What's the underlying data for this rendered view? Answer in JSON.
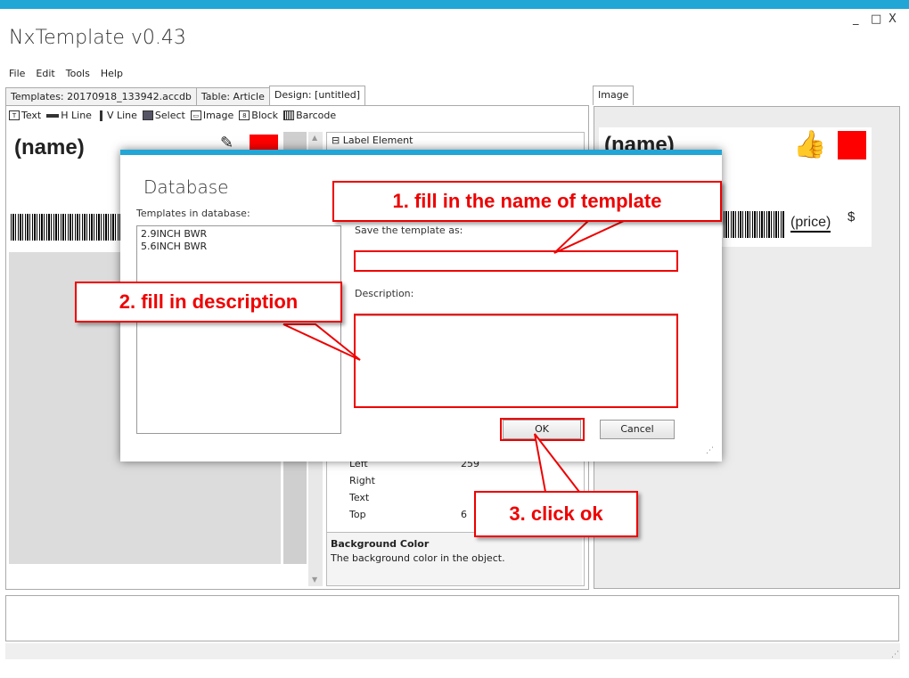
{
  "window": {
    "title": "NxTemplate v0.43",
    "controls": [
      "_",
      "□",
      "X"
    ]
  },
  "menu": [
    "File",
    "Edit",
    "Tools",
    "Help"
  ],
  "tabs": [
    {
      "label": "Templates: 20170918_133942.accdb",
      "active": false
    },
    {
      "label": "Table: Article",
      "active": false
    },
    {
      "label": "Design: [untitled]",
      "active": true
    }
  ],
  "image_tab": "Image",
  "toolbar": [
    {
      "label": "Text",
      "icon": "text-icon"
    },
    {
      "label": "H Line",
      "icon": "hline-icon"
    },
    {
      "label": "V Line",
      "icon": "vline-icon"
    },
    {
      "label": "Select",
      "icon": "select-icon"
    },
    {
      "label": "Image",
      "icon": "image-icon"
    },
    {
      "label": "Block",
      "icon": "block-icon"
    },
    {
      "label": "Barcode",
      "icon": "barcode-icon"
    }
  ],
  "design": {
    "name_field": "(name)"
  },
  "preview": {
    "name_field": "(name)",
    "price_field": "(price)",
    "currency": "$"
  },
  "properties": {
    "category": "Label Element",
    "rows": [
      {
        "name": "Left",
        "value": "259"
      },
      {
        "name": "Right",
        "value": ""
      },
      {
        "name": "Text",
        "value": ""
      },
      {
        "name": "Top",
        "value": "6"
      }
    ],
    "help_title": "Background Color",
    "help_text": "The background color in the object."
  },
  "dialog": {
    "title": "Database",
    "templates_label": "Templates in database:",
    "templates": [
      "2.9INCH BWR",
      "5.6INCH BWR"
    ],
    "save_label": "Save the template as:",
    "save_value": "",
    "description_label": "Description:",
    "description_value": "",
    "ok_label": "OK",
    "cancel_label": "Cancel"
  },
  "annotations": {
    "step1": "1. fill in the name of template",
    "step2": "2. fill in description",
    "step3": "3. click ok"
  },
  "colors": {
    "accent": "#22a6d6",
    "callout_red": "#e00000"
  }
}
